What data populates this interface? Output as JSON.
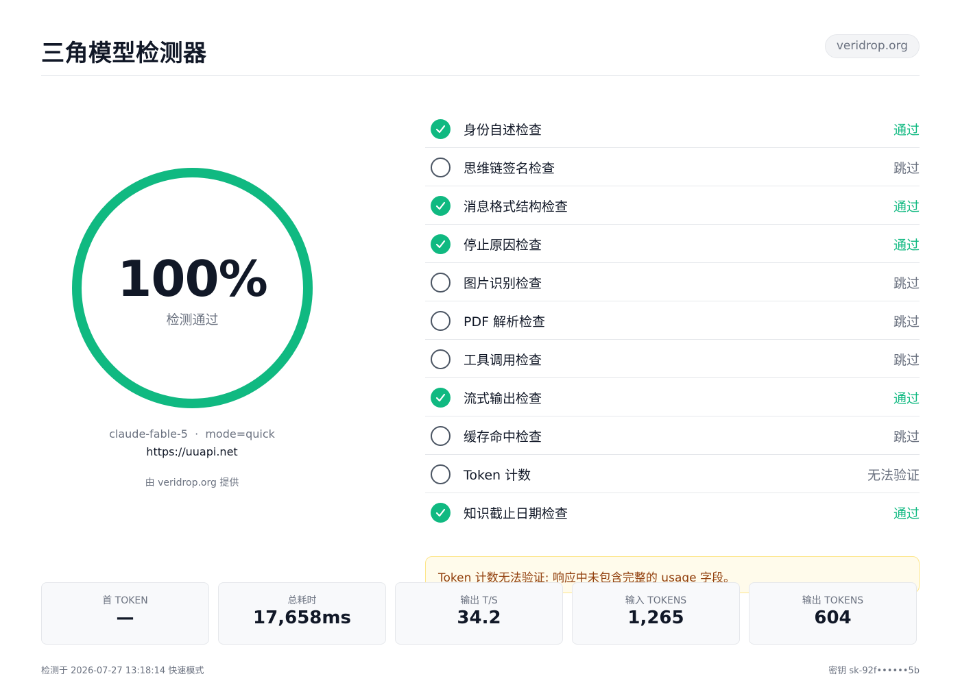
{
  "header": {
    "title": "三角模型检测器",
    "domain": "veridrop.org"
  },
  "score": {
    "value": "100%",
    "label": "检测通过",
    "fraction": 1.0,
    "ring_color": "#10b981"
  },
  "meta": {
    "model_mode": "claude-fable-5  ·  mode=quick",
    "url": "https://uuapi.net",
    "credit": "由 veridrop.org 提供"
  },
  "checks": [
    {
      "label": "身份自述检查",
      "status": "通过",
      "passed": true
    },
    {
      "label": "思维链签名检查",
      "status": "跳过",
      "passed": false
    },
    {
      "label": "消息格式结构检查",
      "status": "通过",
      "passed": true
    },
    {
      "label": "停止原因检查",
      "status": "通过",
      "passed": true
    },
    {
      "label": "图片识别检查",
      "status": "跳过",
      "passed": false
    },
    {
      "label": "PDF 解析检查",
      "status": "跳过",
      "passed": false
    },
    {
      "label": "工具调用检查",
      "status": "跳过",
      "passed": false
    },
    {
      "label": "流式输出检查",
      "status": "通过",
      "passed": true
    },
    {
      "label": "缓存命中检查",
      "status": "跳过",
      "passed": false
    },
    {
      "label": "Token 计数",
      "status": "无法验证",
      "passed": false
    },
    {
      "label": "知识截止日期检查",
      "status": "通过",
      "passed": true
    }
  ],
  "warning": "Token 计数无法验证: 响应中未包含完整的 usage 字段。",
  "stats": [
    {
      "label": "首 TOKEN",
      "value": "—"
    },
    {
      "label": "总耗时",
      "value": "17,658ms"
    },
    {
      "label": "输出 T/S",
      "value": "34.2"
    },
    {
      "label": "输入 TOKENS",
      "value": "1,265"
    },
    {
      "label": "输出 TOKENS",
      "value": "604"
    }
  ],
  "footer": {
    "left": "检测于 2026-07-27 13:18:14 快速模式",
    "right": "密钥 sk-92f••••••5b"
  }
}
